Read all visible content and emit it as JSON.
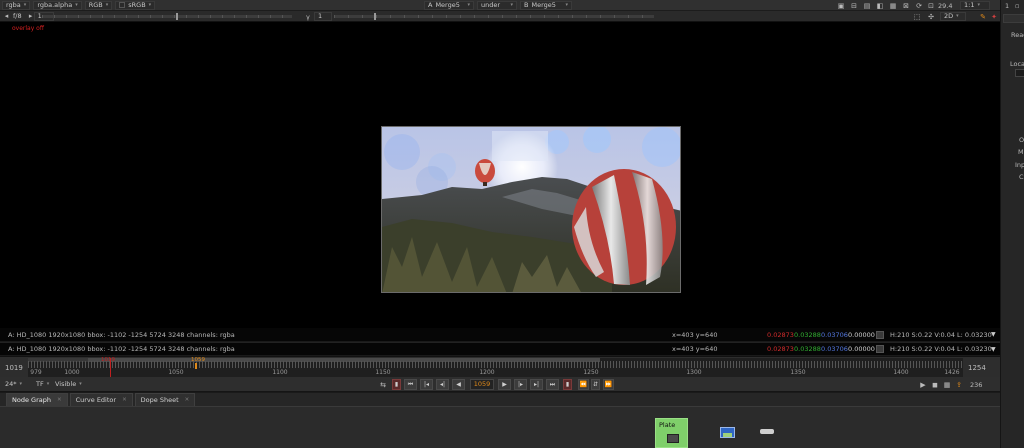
{
  "topbar": {
    "channels": "rgba",
    "alpha_channel": "rgba.alpha",
    "color_space_1": "RGB",
    "color_space_2": "sRGB",
    "input_a_label": "A",
    "input_a_node": "Merge5",
    "compare_mode": "under",
    "input_b_label": "B",
    "input_b_node": "Merge5",
    "fps": "29.4",
    "zoom_ratio": "1:1"
  },
  "secondbar": {
    "frame_step": "f/8",
    "gain_value": "1",
    "gamma_label": "γ",
    "gamma_value": "1",
    "view_mode": "2D"
  },
  "viewer": {
    "overlay_status": "overlay off"
  },
  "info_rows": [
    {
      "label": "A:  HD_1080 1920x1080  bbox: -1102 -1254 5724 3248 channels: rgba",
      "xy": "x=403 y=640",
      "r": "0.02873",
      "g": "0.03288",
      "b": "0.03706",
      "a": "0.00000",
      "hsv": "H:210 S:0.22 V:0.04  L: 0.03230"
    },
    {
      "label": "A:  HD_1080 1920x1080  bbox: -1102 -1254 5724 3248 channels: rgba",
      "xy": "x=403 y=640",
      "r": "0.02873",
      "g": "0.03288",
      "b": "0.03706",
      "a": "0.00000",
      "hsv": "H:210 S:0.22 V:0.04  L: 0.03230"
    }
  ],
  "timeline": {
    "start_frame": "1019",
    "end_frame": "1254",
    "in_point": "1019",
    "current_marker": "1059",
    "labels": [
      "979",
      "1000",
      "1050",
      "1100",
      "1150",
      "1200",
      "1250",
      "1300",
      "1350",
      "1400",
      "1426"
    ]
  },
  "playbar": {
    "fps_setting": "24*",
    "tf_label": "TF",
    "visibility": "Visible",
    "current_frame": "1059",
    "end_field": "236"
  },
  "panel_tabs": [
    {
      "label": "Node Graph"
    },
    {
      "label": "Curve Editor"
    },
    {
      "label": "Dope Sheet"
    }
  ],
  "nodegraph": {
    "plate_node_label": "Plate"
  },
  "right_panel": {
    "tab_number": "1",
    "read_label": "Read",
    "local_label": "Local",
    "o_label": "O",
    "m_label": "M",
    "inp_label": "Inp",
    "c_label": "C"
  },
  "colors": {
    "accent_orange": "#e08a1a",
    "in_point_red": "#c02020",
    "plate_node_green": "#7fcf6a"
  }
}
